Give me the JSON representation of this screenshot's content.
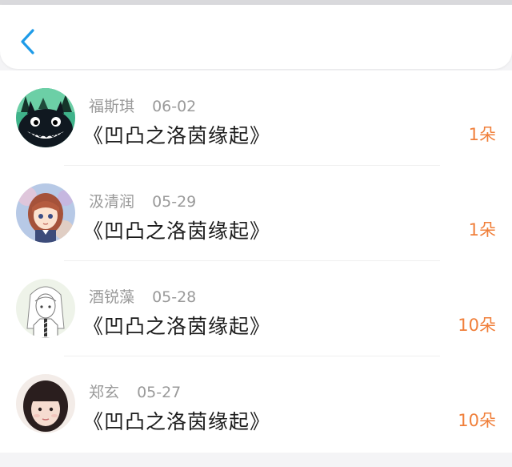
{
  "header": {
    "back_icon": "chevron-left-icon",
    "accent_color": "#1e9be8"
  },
  "records": [
    {
      "name": "福斯琪",
      "date": "06-02",
      "title": "《凹凸之洛茵缘起》",
      "amount": "1朵",
      "avatar": "totoro-avatar"
    },
    {
      "name": "汲清润",
      "date": "05-29",
      "title": "《凹凸之洛茵缘起》",
      "amount": "1朵",
      "avatar": "anime-girl-avatar"
    },
    {
      "name": "酒锐藻",
      "date": "05-28",
      "title": "《凹凸之洛茵缘起》",
      "amount": "10朵",
      "avatar": "sketch-girl-avatar"
    },
    {
      "name": "郑玄",
      "date": "05-27",
      "title": "《凹凸之洛茵缘起》",
      "amount": "10朵",
      "avatar": "photo-girl-avatar"
    }
  ],
  "colors": {
    "amount": "#f07f3a",
    "meta_text": "#9a9a9a",
    "title_text": "#1b1b1b"
  }
}
